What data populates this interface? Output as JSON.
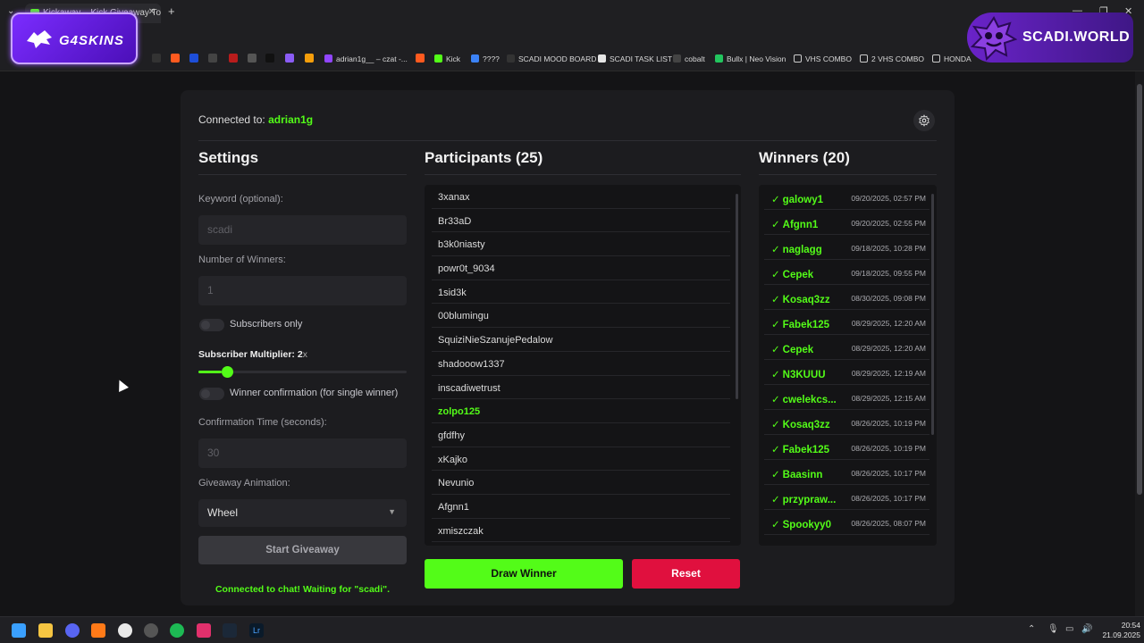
{
  "browser": {
    "tab_title": "Kickaway – Kick Giveaway Tool",
    "bookmarks": [
      {
        "label": "adrian1g__ – czat -...",
        "color": "#9146ff"
      },
      {
        "label": "Kick",
        "color": "#53fc18"
      },
      {
        "label": "????",
        "color": "#3b82f6"
      },
      {
        "label": "SCADI MOOD BOARD",
        "color": "#222222"
      },
      {
        "label": "SCADI TASK LIST",
        "color": "#e5e5e5"
      },
      {
        "label": "cobalt",
        "color": "#222222"
      },
      {
        "label": "Bullx | Neo Vision",
        "color": "#22c55e"
      },
      {
        "label": "VHS COMBO",
        "color": "#cccccc"
      },
      {
        "label": "2 VHS COMBO",
        "color": "#cccccc"
      },
      {
        "label": "HONDA",
        "color": "#cccccc"
      }
    ]
  },
  "overlays": {
    "left_logo": "G4SKINS",
    "right_logo": "SCADI.WORLD"
  },
  "header": {
    "connected_prefix": "Connected to: ",
    "channel": "adrian1g"
  },
  "settings": {
    "title": "Settings",
    "keyword_label": "Keyword (optional):",
    "keyword_value": "scadi",
    "winners_label": "Number of Winners:",
    "winners_value": "1",
    "subscribers_only_label": "Subscribers only",
    "multiplier_label": "Subscriber Multiplier: 2",
    "multiplier_suffix": "x",
    "multiplier_value": 2,
    "multiplier_fraction": 0.11,
    "confirmation_toggle_label": "Winner confirmation (for single winner)",
    "confirmation_time_label": "Confirmation Time (seconds):",
    "confirmation_time_value": "30",
    "animation_label": "Giveaway Animation:",
    "animation_value": "Wheel",
    "start_button": "Start Giveaway",
    "status": "Connected to chat! Waiting for \"scadi\"."
  },
  "participants": {
    "title": "Participants (25)",
    "items": [
      "3xanax",
      "Br33aD",
      "b3k0niasty",
      "powr0t_9034",
      "1sid3k",
      "00blumingu",
      "SquiziNieSzanujePedalow",
      "shadooow1337",
      "inscadiwetrust",
      "zolpo125",
      "gfdfhy",
      "xKajko",
      "Nevunio",
      "Afgnn1",
      "xmiszczak"
    ],
    "highlighted": "zolpo125",
    "draw_button": "Draw Winner",
    "reset_button": "Reset"
  },
  "winners": {
    "title": "Winners (20)",
    "items": [
      {
        "name": "galowy1",
        "time": "09/20/2025, 02:57 PM"
      },
      {
        "name": "Afgnn1",
        "time": "09/20/2025, 02:55 PM"
      },
      {
        "name": "naglagg",
        "time": "09/18/2025, 10:28 PM"
      },
      {
        "name": "Cepek",
        "time": "09/18/2025, 09:55 PM"
      },
      {
        "name": "Kosaq3zz",
        "time": "08/30/2025, 09:08 PM"
      },
      {
        "name": "Fabek125",
        "time": "08/29/2025, 12:20 AM"
      },
      {
        "name": "Cepek",
        "time": "08/29/2025, 12:20 AM"
      },
      {
        "name": "N3KUUU",
        "time": "08/29/2025, 12:19 AM"
      },
      {
        "name": "cwelekcs...",
        "time": "08/29/2025, 12:15 AM"
      },
      {
        "name": "Kosaq3zz",
        "time": "08/26/2025, 10:19 PM"
      },
      {
        "name": "Fabek125",
        "time": "08/26/2025, 10:19 PM"
      },
      {
        "name": "Baasinn",
        "time": "08/26/2025, 10:17 PM"
      },
      {
        "name": "przypraw...",
        "time": "08/26/2025, 10:17 PM"
      },
      {
        "name": "Spookyy0",
        "time": "08/26/2025, 08:07 PM"
      }
    ]
  },
  "taskbar": {
    "time": "20:54",
    "date": "21.09.2025"
  },
  "colors": {
    "accent": "#53fc18",
    "danger": "#e0103e"
  }
}
